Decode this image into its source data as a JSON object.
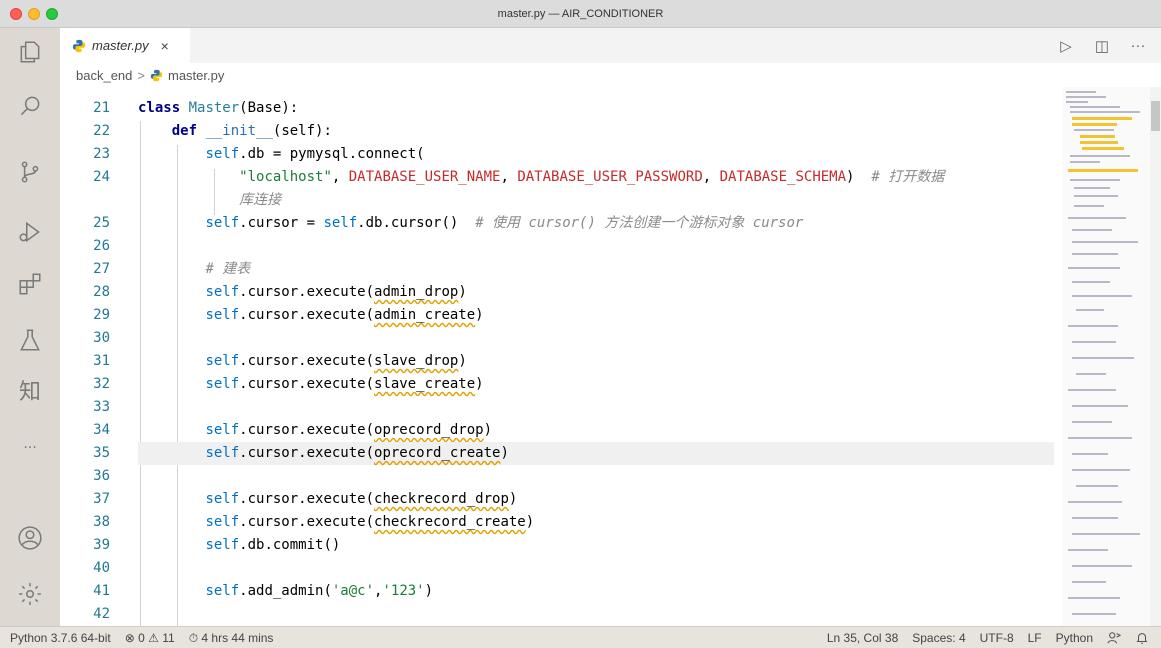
{
  "window": {
    "title": "master.py — AIR_CONDITIONER"
  },
  "activity_bar": [
    {
      "name": "explorer-icon"
    },
    {
      "name": "search-icon"
    },
    {
      "name": "source-control-icon"
    },
    {
      "name": "run-debug-icon"
    },
    {
      "name": "extensions-icon"
    },
    {
      "name": "testing-icon"
    },
    {
      "name": "zhihu-icon",
      "text": "知"
    },
    {
      "name": "more-icon",
      "text": "···"
    },
    {
      "name": "account-icon"
    },
    {
      "name": "settings-gear-icon"
    }
  ],
  "tabs": [
    {
      "label": "master.py",
      "close": "×"
    }
  ],
  "editor_actions": {
    "run": "▷",
    "split": "◫",
    "more": "···"
  },
  "breadcrumb": {
    "folder": "back_end",
    "separator": ">",
    "file": "master.py"
  },
  "editor": {
    "line_numbers": [
      "21",
      "22",
      "23",
      "24",
      "",
      "25",
      "26",
      "27",
      "28",
      "29",
      "30",
      "31",
      "32",
      "33",
      "34",
      "35",
      "36",
      "37",
      "38",
      "39",
      "40",
      "41",
      "42"
    ],
    "comments": {
      "line24": "# 打开数据",
      "line24_wrap": "库连接",
      "line25": "# 使用 cursor() 方法创建一个游标对象 cursor",
      "line27": "# 建表"
    },
    "strings": {
      "localhost": "\"localhost\"",
      "a_c": "'a@c'",
      "pw": "'123'"
    }
  },
  "status": {
    "python": "Python 3.7.6 64-bit",
    "errors": "⊗ 0",
    "warnings": "⚠ 11",
    "time": "⏱ 4 hrs 44 mins",
    "position": "Ln 35, Col 38",
    "spaces": "Spaces: 4",
    "encoding": "UTF-8",
    "eol": "LF",
    "language": "Python",
    "feedback_icon": "feedback-icon",
    "bell_icon": "bell-icon"
  }
}
